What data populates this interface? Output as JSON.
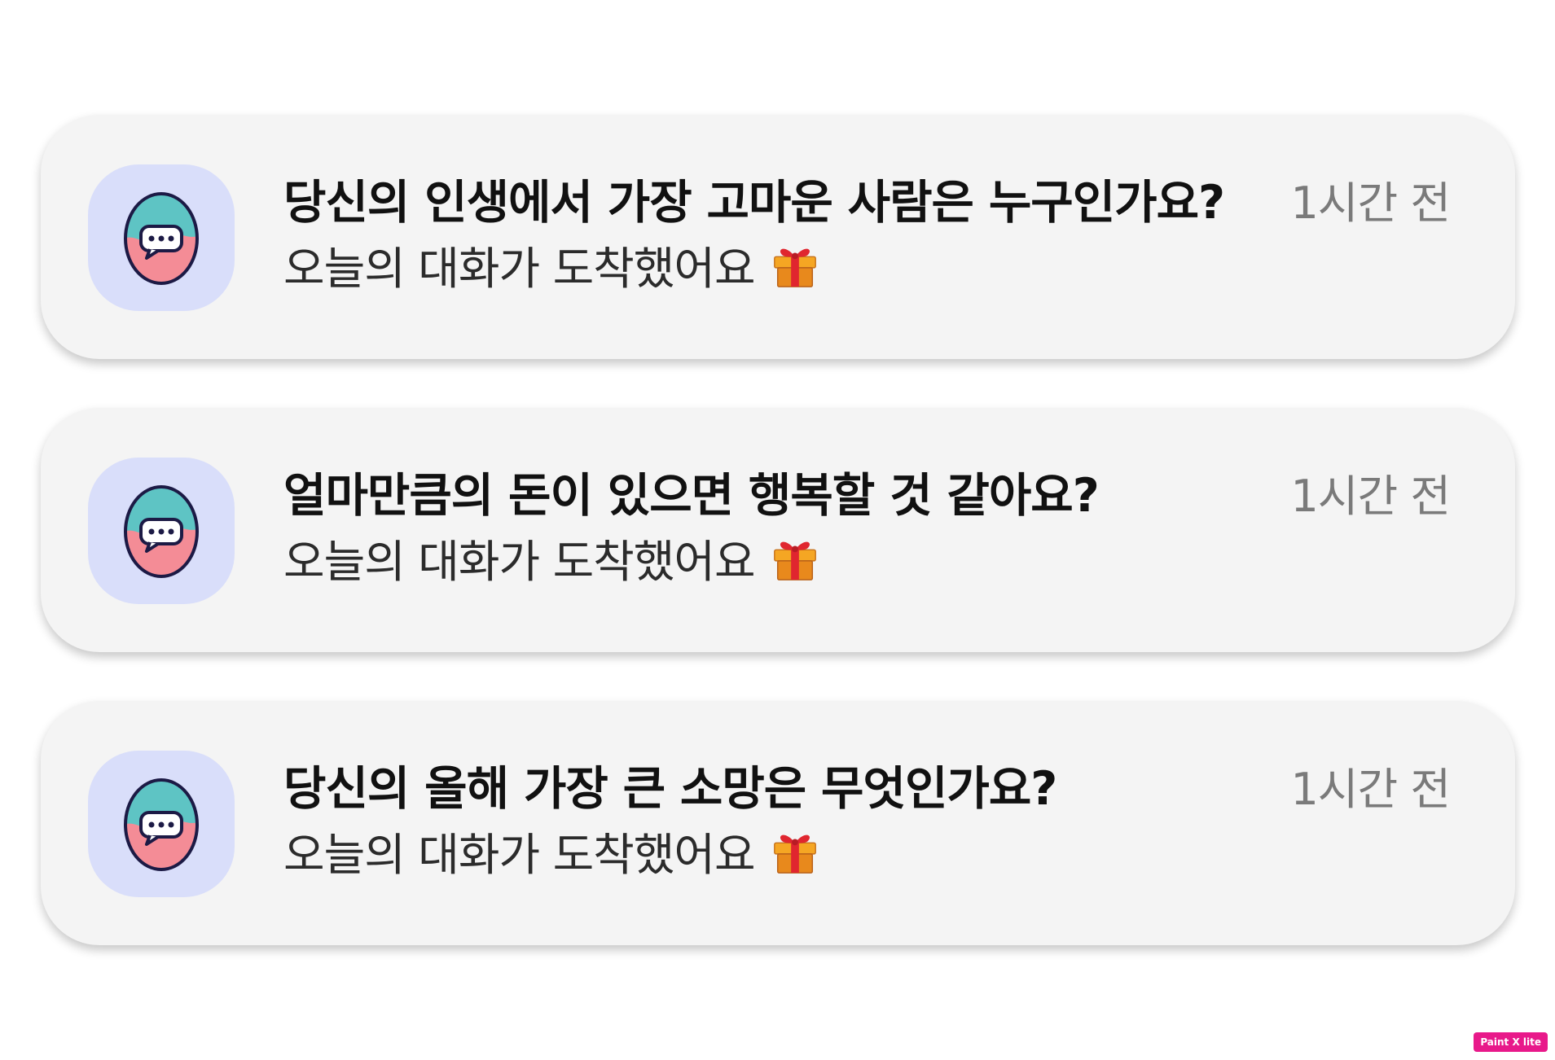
{
  "notifications": [
    {
      "title": "당신의 인생에서 가장 고마운 사람은 누구인가요?",
      "subtitle": "오늘의 대화가 도착했어요",
      "time": "1시간 전",
      "app_icon": "egg-chat-bubble-icon",
      "emoji_icon": "gift-icon"
    },
    {
      "title": "얼마만큼의 돈이 있으면 행복할 것 같아요?",
      "subtitle": "오늘의 대화가 도착했어요",
      "time": "1시간 전",
      "app_icon": "egg-chat-bubble-icon",
      "emoji_icon": "gift-icon"
    },
    {
      "title": "당신의 올해 가장 큰 소망은 무엇인가요?",
      "subtitle": "오늘의 대화가 도착했어요",
      "time": "1시간 전",
      "app_icon": "egg-chat-bubble-icon",
      "emoji_icon": "gift-icon"
    }
  ],
  "watermark": {
    "label": "Paint X lite"
  },
  "colors": {
    "card_background": "#f4f4f4",
    "app_icon_background": "#d9defa",
    "egg_top": "#5ec4c4",
    "egg_bottom": "#f48c96",
    "watermark_background": "#e8198a"
  }
}
